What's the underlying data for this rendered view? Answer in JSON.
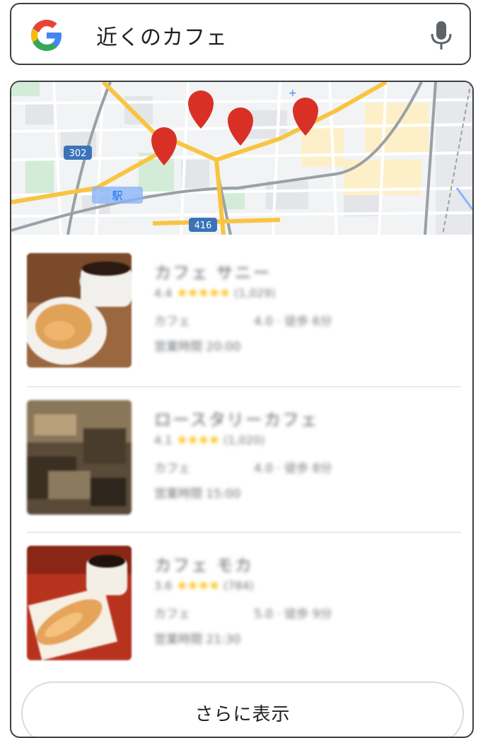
{
  "search": {
    "query": "近くのカフェ"
  },
  "map": {
    "route_labels": [
      "302",
      "416"
    ],
    "station_label": "駅"
  },
  "results": [
    {
      "name": "カフェ サニー",
      "rating": "4.4",
      "stars": "★★★★★",
      "reviews": "(1,029)",
      "category": "カフェ",
      "distance": "4.0 · 徒歩 6分",
      "hours": "営業時間 20:00"
    },
    {
      "name": "ロースタリーカフェ",
      "rating": "4.1",
      "stars": "★★★★",
      "reviews": "(1,020)",
      "category": "カフェ",
      "distance": "4.0 · 徒歩 8分",
      "hours": "営業時間 15:00"
    },
    {
      "name": "カフェ モカ",
      "rating": "3.6",
      "stars": "★★★★",
      "reviews": "(784)",
      "category": "カフェ",
      "distance": "5.0 · 徒歩 9分",
      "hours": "営業時間 21:30"
    }
  ],
  "more_button": {
    "label": "さらに表示"
  }
}
